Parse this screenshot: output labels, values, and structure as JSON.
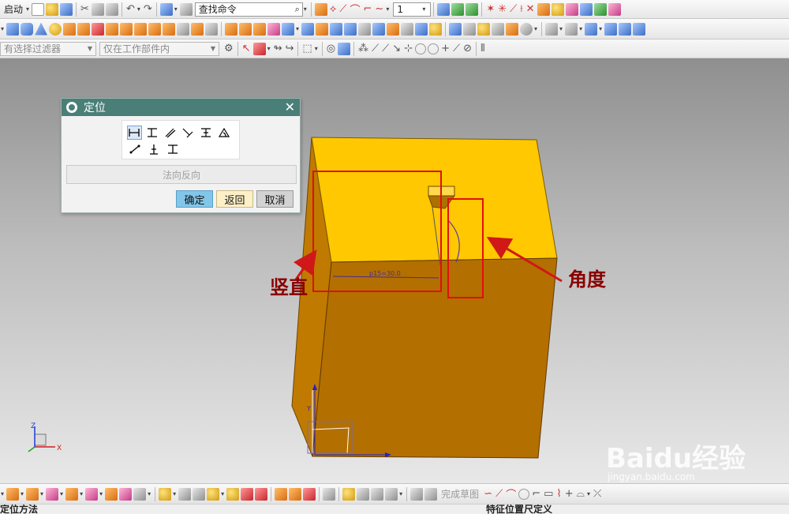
{
  "toolbar_top": {
    "start_label": "启动",
    "search_placeholder": "查找命令",
    "layer_value": "1"
  },
  "selection_bar": {
    "filter_placeholder": "有选择过滤器",
    "scope_value": "仅在工作部件内"
  },
  "dialog": {
    "title": "定位",
    "reverse_label": "法向反向",
    "ok_label": "确定",
    "back_label": "返回",
    "cancel_label": "取消"
  },
  "annotations": {
    "vertical_label": "竖直",
    "angle_label": "角度",
    "dimension_text": "p15=30.0"
  },
  "axis": {
    "x": "X",
    "y": "Y",
    "z": "Z"
  },
  "bottom_toolbar": {
    "finish_sketch_label": "完成草图"
  },
  "statusbar": {
    "left": "定位方法",
    "right": "特征位置尺定义"
  },
  "watermark": {
    "brand": "Baidu经验",
    "url": "jingyan.baidu.com"
  },
  "colors": {
    "accent_title": "#4a7f78",
    "top_face": "#ffc800",
    "front_face": "#b36f00",
    "left_face": "#c07a00",
    "highlight_box": "#e01010",
    "arrow": "#d01818"
  },
  "icons": {
    "new": "new-file-icon",
    "open": "open-folder-icon",
    "save": "save-icon",
    "cut": "cut-icon",
    "copy": "copy-icon",
    "paste": "paste-icon",
    "undo": "undo-icon",
    "redo": "redo-icon",
    "gear": "gear-icon",
    "close": "close-icon"
  }
}
